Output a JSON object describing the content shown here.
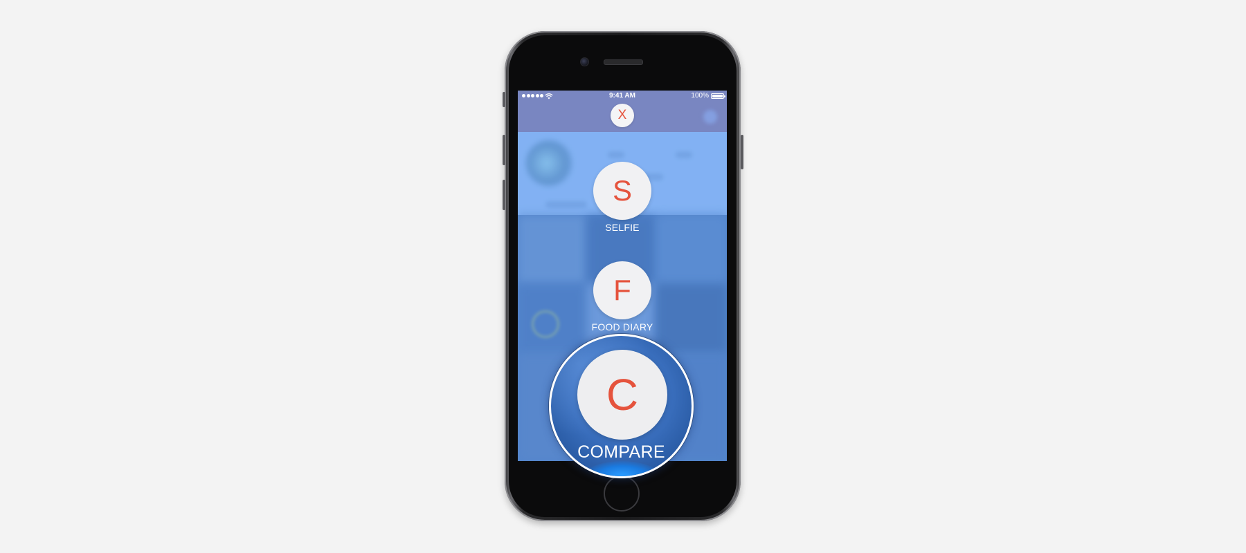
{
  "status_bar": {
    "time": "9:41 AM",
    "battery": "100%"
  },
  "menu": {
    "close_label": "X",
    "items": [
      {
        "letter": "S",
        "label": "SELFIE"
      },
      {
        "letter": "F",
        "label": "FOOD DIARY"
      },
      {
        "letter": "C",
        "label": "COMPARE"
      }
    ]
  },
  "colors": {
    "accent": "#e5533d",
    "background": "#f3f3f3",
    "screen_blue": "#6fa4e6",
    "top_bar_purple": "#7a73a8"
  }
}
